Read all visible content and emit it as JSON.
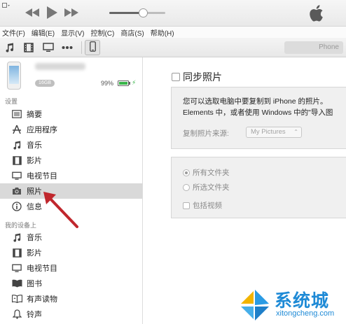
{
  "window": {
    "control_glyph": "▾",
    "volume_level": 0.6
  },
  "player": {
    "buttons": [
      "rewind-icon",
      "play-icon",
      "fast-forward-icon"
    ]
  },
  "menu": [
    "文件(F)",
    "编辑(E)",
    "显示(V)",
    "控制(C)",
    "商店(S)",
    "帮助(H)"
  ],
  "toolbar": {
    "media_icons": [
      "music-note-icon",
      "film-icon",
      "tv-icon",
      "more-dots-icon"
    ],
    "device_name_suffix": "Phone"
  },
  "device": {
    "capacity": "16GB",
    "battery_percent": "99%",
    "battery_level": 0.99,
    "charging_glyph": "⚡"
  },
  "sidebar": {
    "settings_label": "设置",
    "settings_items": [
      {
        "icon": "list-icon",
        "label": "摘要"
      },
      {
        "icon": "apps-icon",
        "label": "应用程序"
      },
      {
        "icon": "music-note-icon",
        "label": "音乐"
      },
      {
        "icon": "film-icon",
        "label": "影片"
      },
      {
        "icon": "tv-icon",
        "label": "电视节目"
      },
      {
        "icon": "camera-icon",
        "label": "照片",
        "selected": true
      },
      {
        "icon": "info-icon",
        "label": "信息"
      }
    ],
    "mydevice_label": "我的设备上",
    "mydevice_items": [
      {
        "icon": "music-note-icon",
        "label": "音乐"
      },
      {
        "icon": "film-icon",
        "label": "影片"
      },
      {
        "icon": "tv-icon",
        "label": "电视节目"
      },
      {
        "icon": "book-icon",
        "label": "图书"
      },
      {
        "icon": "audiobook-icon",
        "label": "有声读物"
      },
      {
        "icon": "bell-icon",
        "label": "铃声"
      }
    ]
  },
  "main": {
    "sync_label": "同步照片",
    "description_line1": "您可以选取电脑中要复制到 iPhone 的照片。",
    "description_line2": "Elements 中，或者使用 Windows 中的\"导入图",
    "source_label": "复制照片来源:",
    "source_value": "My Pictures",
    "source_arrow": "⌃",
    "option_all_folders": "所有文件夹",
    "option_selected_folders": "所选文件夹",
    "option_include_videos": "包括视频"
  },
  "watermark": {
    "title": "系统城",
    "url": "xitongcheng.com"
  },
  "colors": {
    "accent": "#1e8ad6",
    "annotation": "#c0272d",
    "battery": "#39b54a"
  }
}
